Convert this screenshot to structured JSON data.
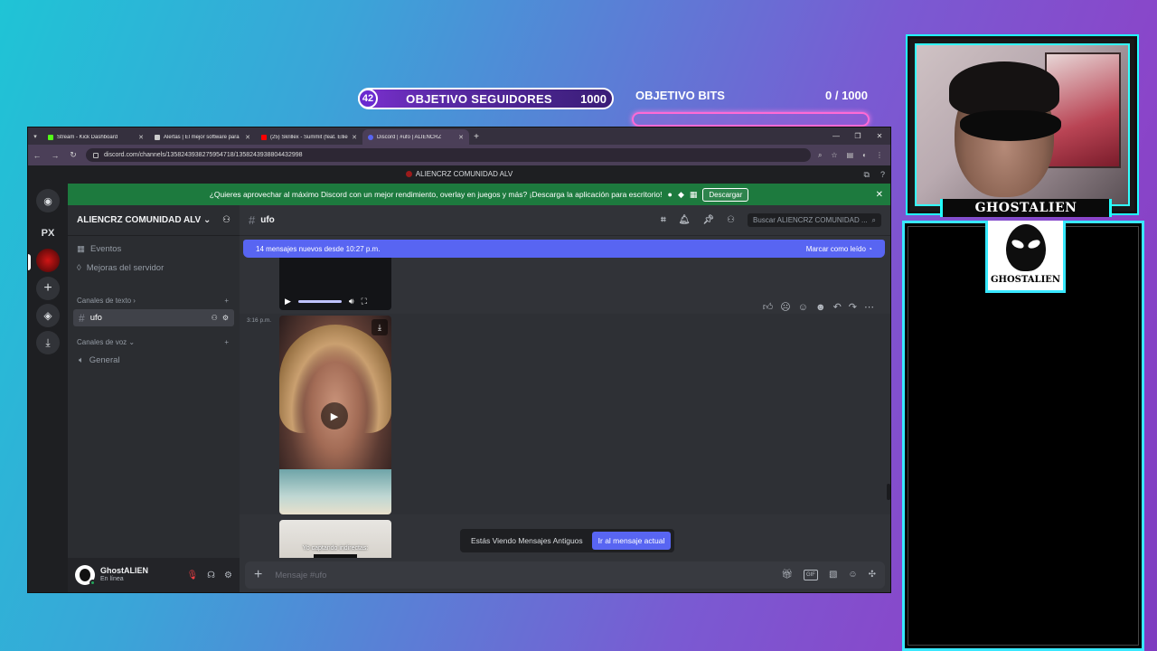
{
  "overlay": {
    "followers_goal": {
      "current": "42",
      "label": "OBJETIVO SEGUIDORES",
      "max": "1000"
    },
    "bits_goal": {
      "label": "OBJETIVO BITS",
      "value": "0 / 1000",
      "progress": 0
    },
    "streamer_name": "GHOSTALIEN",
    "logo_text": "GHOSTALIEN",
    "accent_color": "#38e8ff"
  },
  "browser": {
    "tabs": [
      {
        "label": "Stream - Kick Dashboard",
        "icon_color": "#53fc18"
      },
      {
        "label": "Alertas | El mejor software para",
        "icon_color": "#cccccc"
      },
      {
        "label": "(25) Skrillex - Summit (feat. Ellie",
        "icon_color": "#ff0000"
      },
      {
        "label": "Discord | #ufo | ALIENCRZ",
        "icon_color": "#5865f2"
      }
    ],
    "url": "discord.com/channels/1358243938275954718/1358243938804432998"
  },
  "discord": {
    "window_title": "ALIENCRZ COMUNIDAD ALV",
    "banner": {
      "text": "¿Quieres aprovechar al máximo Discord con un mejor rendimiento, overlay en juegos y más? ¡Descarga la aplicación para escritorio!",
      "button": "Descargar"
    },
    "guilds": {
      "px_label": "PX"
    },
    "server_name": "ALIENCRZ COMUNIDAD ALV",
    "sidebar": {
      "events": "Eventos",
      "boost": "Mejoras del servidor",
      "text_category": "Canales de texto",
      "voice_category": "Canales de voz",
      "text_channel": "ufo",
      "voice_channel": "General"
    },
    "user": {
      "name": "GhostALIEN",
      "status": "En línea"
    },
    "channel": {
      "name": "ufo",
      "search_placeholder": "Buscar ALIENCRZ COMUNIDAD ...",
      "new_messages": "14 mensajes nuevos desde 10:27 p.m.",
      "mark_read": "Marcar como leído",
      "timestamp": "3:16 p.m.",
      "video_caption": "Yo captando indirectas:",
      "old_messages": "Estás Viendo Mensajes Antiguos",
      "jump_button": "Ir al mensaje actual",
      "composer_placeholder": "Mensaje #ufo"
    }
  }
}
